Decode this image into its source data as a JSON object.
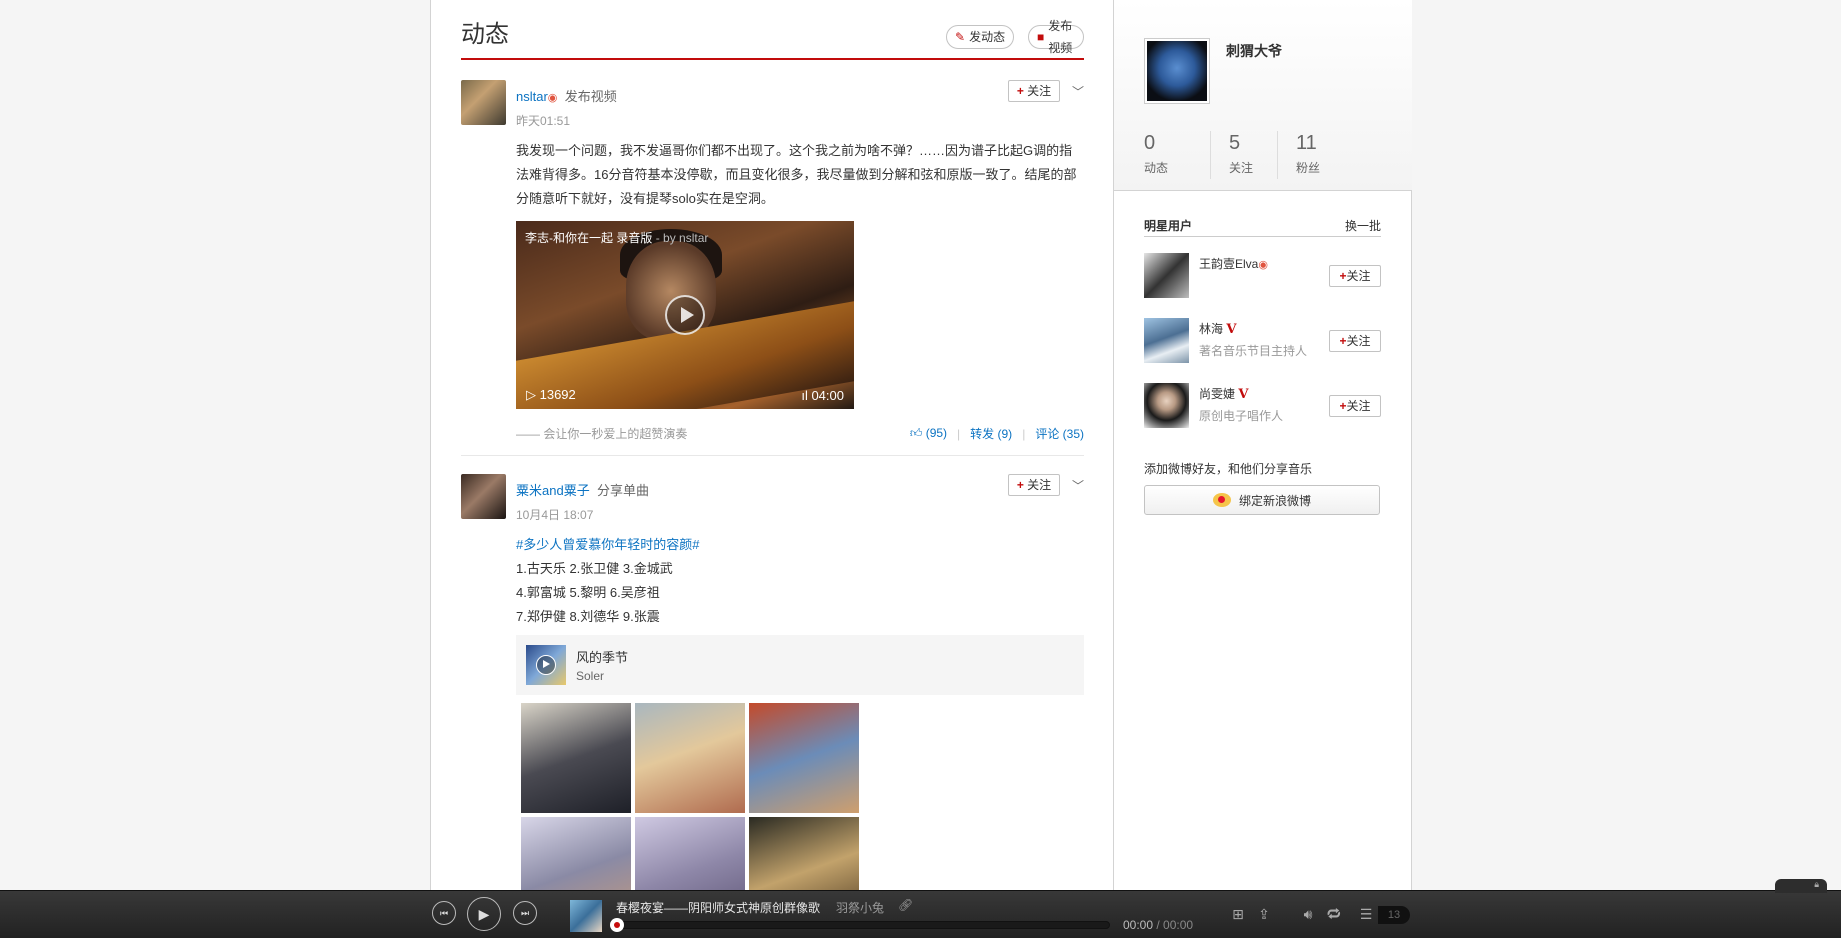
{
  "header": {
    "title": "动态",
    "post_label": "发动态",
    "video_label": "发布视频"
  },
  "feed": [
    {
      "user": "nsltar",
      "action": "发布视频",
      "time": "昨天01:51",
      "follow_label": "关注",
      "text": "我发现一个问题，我不发逼哥你们都不出现了。这个我之前为啥不弹？……因为谱子比起G调的指法难背得多。16分音符基本没停歇，而且变化很多，我尽量做到分解和弦和原版一致了。结尾的部分随意听下就好，没有提琴solo实在是空洞。",
      "video": {
        "title": "李志-和你在一起 录音版",
        "by": "- by nsltar",
        "plays": "13692",
        "duration": "04:00"
      },
      "quote": "—— 会让你一秒爱上的超赞演奏",
      "like": "(95)",
      "share": "转发 (9)",
      "comment": "评论 (35)"
    },
    {
      "user": "粟米and粟子",
      "action": "分享单曲",
      "time": "10月4日 18:07",
      "follow_label": "关注",
      "tag": "#多少人曾爱慕你年轻时的容颜#",
      "lines": [
        "1.古天乐 2.张卫健 3.金城武",
        "4.郭富城 5.黎明 6.吴彦祖",
        "7.郑伊健 8.刘德华 9.张震"
      ],
      "song": {
        "name": "风的季节",
        "artist": "Soler"
      }
    }
  ],
  "profile": {
    "name": "刺猬大爷",
    "stats": [
      {
        "num": "0",
        "label": "动态"
      },
      {
        "num": "5",
        "label": "关注"
      },
      {
        "num": "11",
        "label": "粉丝"
      }
    ]
  },
  "stars": {
    "title": "明星用户",
    "change": "换一批",
    "follow_label": "关注",
    "users": [
      {
        "name": "王韵壹Elva",
        "desc": "",
        "badge": ""
      },
      {
        "name": "林海",
        "desc": "著名音乐节目主持人",
        "badge": "V"
      },
      {
        "name": "尚雯婕",
        "desc": "原创电子唱作人",
        "badge": "V"
      }
    ]
  },
  "bind": {
    "tip": "添加微博好友，和他们分享音乐",
    "button": "绑定新浪微博"
  },
  "player": {
    "title": "春樱夜宴——阴阳师女式神原创群像歌",
    "artist": "羽祭小兔",
    "time": "00:00",
    "duration": "/ 00:00",
    "playlist_count": "13",
    "progress": 0
  }
}
